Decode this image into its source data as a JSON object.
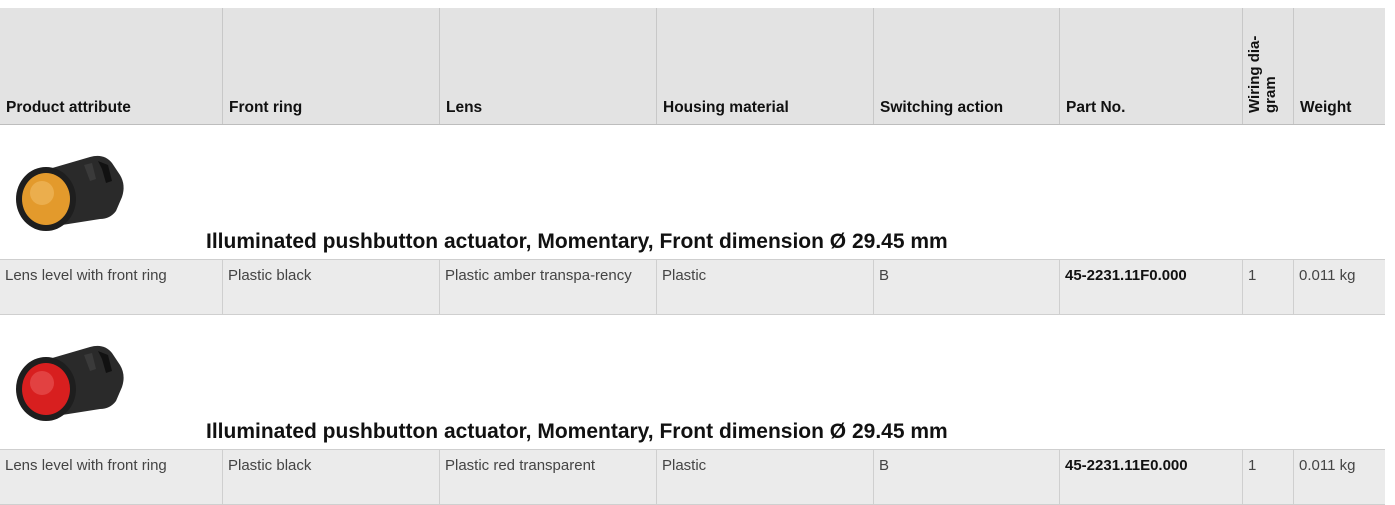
{
  "table": {
    "headers": {
      "product_attribute": "Product attribute",
      "front_ring": "Front ring",
      "lens": "Lens",
      "housing_material": "Housing material",
      "switching_action": "Switching action",
      "part_no": "Part No.",
      "wiring_diagram_line1": "Wiring dia-",
      "wiring_diagram_line2": "gram",
      "weight": "Weight"
    }
  },
  "products": [
    {
      "title": "Illuminated pushbutton actuator, Momentary, Front dimension Ø 29.45 mm",
      "lens_color": "#e39a2c",
      "image_icon": "amber-pushbutton-image",
      "row": {
        "product_attribute": "Lens level with front ring",
        "front_ring": "Plastic black",
        "lens": "Plastic amber transpa-rency",
        "housing_material": "Plastic",
        "switching_action": "B",
        "part_no": "45-2231.11F0.000",
        "wiring_diagram": "1",
        "weight": "0.011 kg"
      }
    },
    {
      "title": "Illuminated pushbutton actuator, Momentary, Front dimension Ø 29.45 mm",
      "lens_color": "#d81f1f",
      "image_icon": "red-pushbutton-image",
      "row": {
        "product_attribute": "Lens level with front ring",
        "front_ring": "Plastic black",
        "lens": "Plastic red transparent",
        "housing_material": "Plastic",
        "switching_action": "B",
        "part_no": "45-2231.11E0.000",
        "wiring_diagram": "1",
        "weight": "0.011 kg"
      }
    }
  ]
}
